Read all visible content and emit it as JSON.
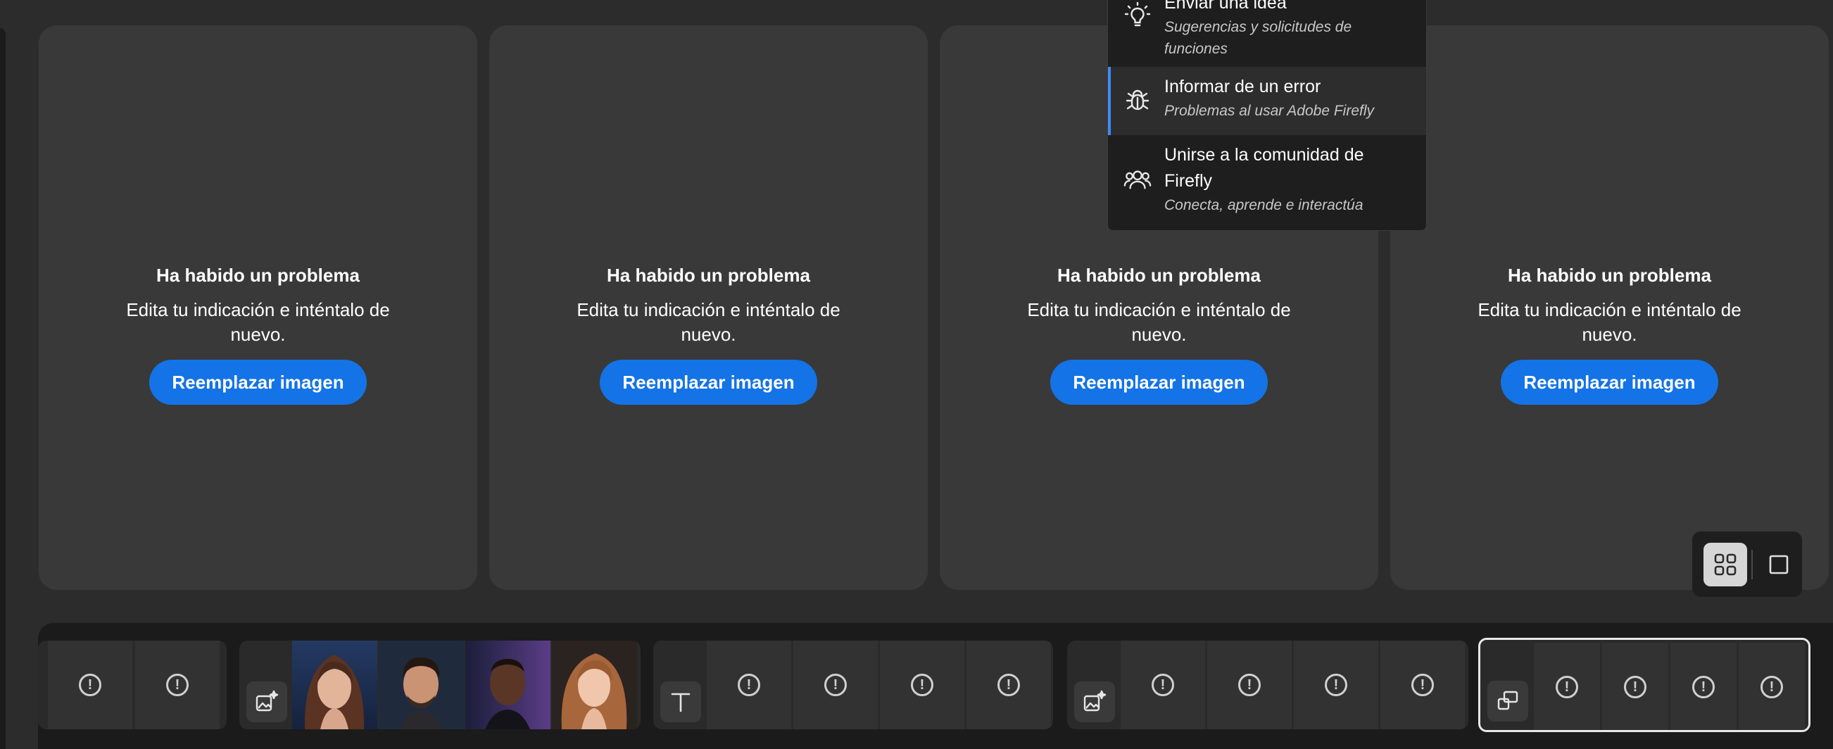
{
  "cards": [
    {
      "title": "Ha habido un problema",
      "message": "Edita tu indicación e inténtalo de nuevo.",
      "button": "Reemplazar imagen"
    },
    {
      "title": "Ha habido un problema",
      "message": "Edita tu indicación e inténtalo de nuevo.",
      "button": "Reemplazar imagen"
    },
    {
      "title": "Ha habido un problema",
      "message": "Edita tu indicación e inténtalo de nuevo.",
      "button": "Reemplazar imagen"
    },
    {
      "title": "Ha habido un problema",
      "message": "Edita tu indicación e inténtalo de nuevo.",
      "button": "Reemplazar imagen"
    }
  ],
  "menu": {
    "items": [
      {
        "icon": "lightbulb-icon",
        "title": "Enviar una idea",
        "subtitle": "Sugerencias y solicitudes de funciones"
      },
      {
        "icon": "bug-icon",
        "title": "Informar de un error",
        "subtitle": "Problemas al usar Adobe Firefly",
        "active": true
      },
      {
        "icon": "community-icon",
        "title": "Unirse a la comunidad de Firefly",
        "subtitle": "Conecta, aprende e interactúa"
      }
    ]
  },
  "view_toggle": {
    "options": [
      "grid-view-icon",
      "single-view-icon"
    ],
    "selected": "grid-view-icon"
  },
  "history": {
    "groups": [
      {
        "type_icon": null,
        "cells": [
          "warning",
          "warning"
        ]
      },
      {
        "type_icon": "generate-image-icon",
        "cells": [
          "portrait",
          "portrait",
          "portrait",
          "portrait"
        ]
      },
      {
        "type_icon": "text-icon",
        "cells": [
          "warning",
          "warning",
          "warning",
          "warning"
        ]
      },
      {
        "type_icon": "generate-image-icon",
        "cells": [
          "warning",
          "warning",
          "warning",
          "warning"
        ]
      },
      {
        "type_icon": "composition-icon",
        "cells": [
          "warning",
          "warning",
          "warning",
          "warning"
        ],
        "selected": true
      }
    ]
  },
  "colors": {
    "accent": "#1473e6",
    "background": "#2c2c2c",
    "card": "#393939",
    "menu": "#1e1e1e"
  }
}
